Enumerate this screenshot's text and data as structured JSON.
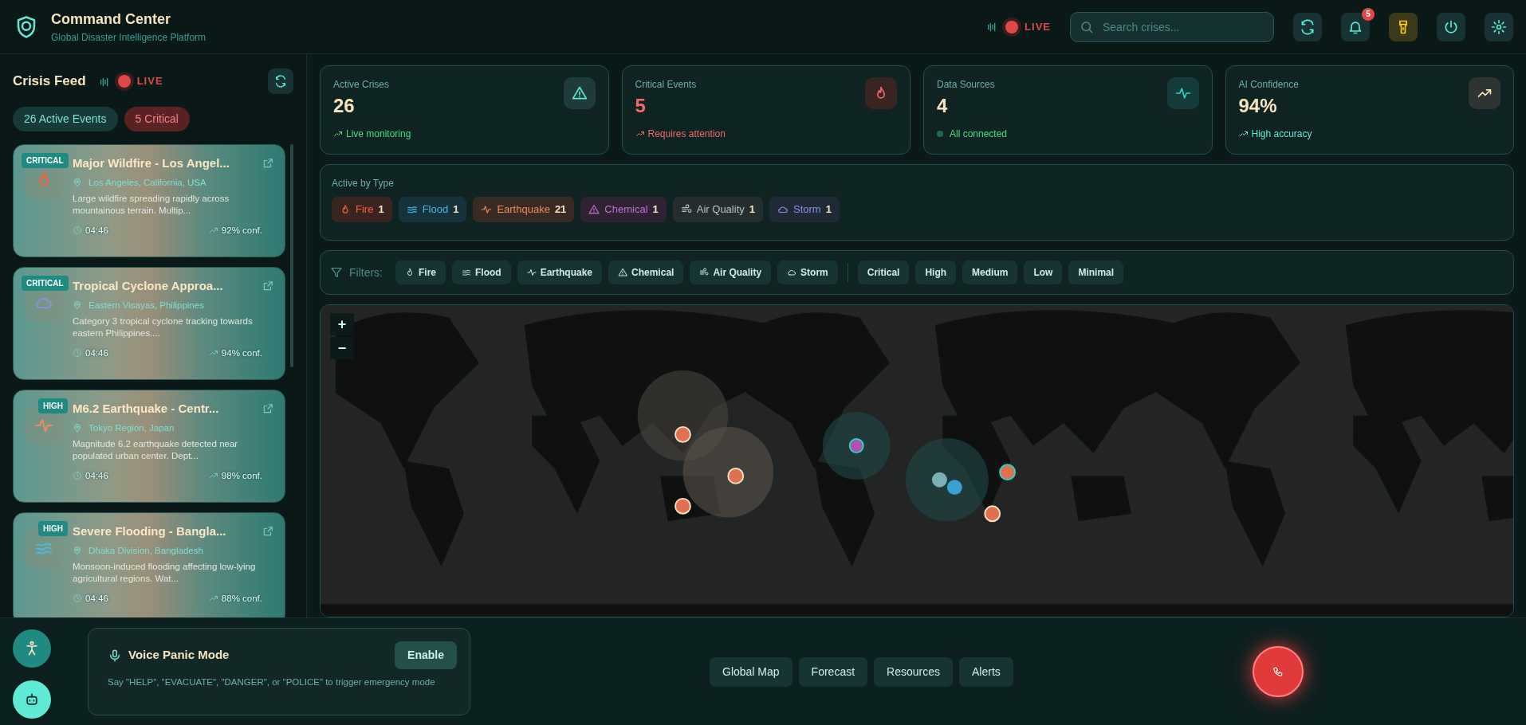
{
  "header": {
    "title": "Command Center",
    "subtitle": "Global Disaster Intelligence Platform",
    "live": "LIVE",
    "search_placeholder": "Search crises...",
    "notifications": "5",
    "flashlight_on": true
  },
  "feed": {
    "title": "Crisis Feed",
    "live": "LIVE",
    "counts": [
      {
        "kind": "active",
        "text": "26 Active Events"
      },
      {
        "kind": "critical",
        "text": "5 Critical"
      }
    ],
    "events": [
      {
        "severity": "CRITICAL",
        "kind": "fire",
        "title": "Major Wildfire - Los Angel...",
        "location": "Los Angeles, California, USA",
        "description": "Large wildfire spreading rapidly across mountainous terrain. Multip...",
        "time": "04:46",
        "confidence": "92% conf."
      },
      {
        "severity": "CRITICAL",
        "kind": "storm",
        "title": "Tropical Cyclone Approa...",
        "location": "Eastern Visayas, Philippines",
        "description": "Category 3 tropical cyclone tracking towards eastern Philippines....",
        "time": "04:46",
        "confidence": "94% conf."
      },
      {
        "severity": "HIGH",
        "kind": "earthquake",
        "title": "M6.2 Earthquake - Centr...",
        "location": "Tokyo Region, Japan",
        "description": "Magnitude 6.2 earthquake detected near populated urban center. Dept...",
        "time": "04:46",
        "confidence": "98% conf."
      },
      {
        "severity": "HIGH",
        "kind": "flood",
        "title": "Severe Flooding - Bangla...",
        "location": "Dhaka Division, Bangladesh",
        "description": "Monsoon-induced flooding affecting low-lying agricultural regions. Wat...",
        "time": "04:46",
        "confidence": "88% conf."
      }
    ]
  },
  "stats": [
    {
      "kind": "active",
      "label": "Active Crises",
      "value": "26",
      "note": "Live monitoring"
    },
    {
      "kind": "critical",
      "label": "Critical Events",
      "value": "5",
      "note": "Requires attention"
    },
    {
      "kind": "sources",
      "label": "Data Sources",
      "value": "4",
      "note": "All connected"
    },
    {
      "kind": "confidence",
      "label": "AI Confidence",
      "value": "94%",
      "note": "High accuracy"
    }
  ],
  "active_by_type": {
    "title": "Active by Type",
    "items": [
      {
        "kind": "fire",
        "label": "Fire",
        "count": "1"
      },
      {
        "kind": "flood",
        "label": "Flood",
        "count": "1"
      },
      {
        "kind": "earthquake",
        "label": "Earthquake",
        "count": "21"
      },
      {
        "kind": "chemical",
        "label": "Chemical",
        "count": "1"
      },
      {
        "kind": "air",
        "label": "Air Quality",
        "count": "1"
      },
      {
        "kind": "storm",
        "label": "Storm",
        "count": "1"
      }
    ]
  },
  "filters": {
    "label": "Filters:",
    "types": [
      {
        "kind": "fire",
        "label": "Fire"
      },
      {
        "kind": "flood",
        "label": "Flood"
      },
      {
        "kind": "earthquake",
        "label": "Earthquake"
      },
      {
        "kind": "chemical",
        "label": "Chemical"
      },
      {
        "kind": "air",
        "label": "Air Quality"
      },
      {
        "kind": "storm",
        "label": "Storm"
      }
    ],
    "severities": [
      "Critical",
      "High",
      "Medium",
      "Low",
      "Minimal"
    ]
  },
  "map": {
    "zoom_in": "+",
    "zoom_out": "−"
  },
  "voice": {
    "title": "Voice Panic Mode",
    "button": "Enable",
    "hint": "Say \"HELP\", \"EVACUATE\", \"DANGER\", or \"POLICE\" to trigger emergency mode"
  },
  "nav": [
    "Global Map",
    "Forecast",
    "Resources",
    "Alerts"
  ]
}
